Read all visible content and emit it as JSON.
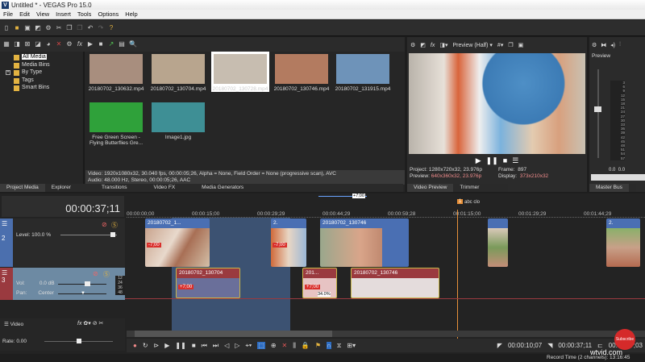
{
  "app": {
    "title": "Untitled * - VEGAS Pro 15.0",
    "logo": "V"
  },
  "menu": [
    "File",
    "Edit",
    "View",
    "Insert",
    "Tools",
    "Options",
    "Help"
  ],
  "media": {
    "tree": [
      {
        "label": "All Media",
        "selected": true
      },
      {
        "label": "Media Bins"
      },
      {
        "label": "By Type",
        "expandable": true
      },
      {
        "label": "Tags"
      },
      {
        "label": "Smart Bins"
      }
    ],
    "thumbs": [
      {
        "label": "20180702_130632.mp4",
        "bg": "#a88e7e"
      },
      {
        "label": "20180702_130704.mp4",
        "bg": "#b8a58e"
      },
      {
        "label": "20180702_130728.mp4",
        "bg": "#c7bdb0",
        "selected": true
      },
      {
        "label": "20180702_130746.mp4",
        "bg": "#b37b60"
      },
      {
        "label": "20180702_131915.mp4",
        "bg": "#6e93b9"
      },
      {
        "label": "Free Green Screen - Flying Butterflies Gre...",
        "bg": "#2fa13a"
      },
      {
        "label": "Image1.jpg",
        "bg": "#3e8f95"
      }
    ],
    "info_video": "Video: 1920x1080x32, 30.040 fps, 00:00:05;26, Alpha = None, Field Order = None (progressive scan), AVC",
    "info_audio": "Audio: 48.000 Hz, Stereo, 00:00:05;26, AAC",
    "tabs": [
      "Project Media",
      "Explorer",
      "Transitions",
      "Video FX",
      "Media Generators"
    ]
  },
  "preview": {
    "quality": "Preview (Half)",
    "project_label": "Project:",
    "project": "1280x720x32, 23.976p",
    "preview_label": "Preview:",
    "preview": "640x360x32, 23.976p",
    "frame_label": "Frame:",
    "frame": "897",
    "display_label": "Display:",
    "display": "373x210x32",
    "tabs": [
      "Video Preview",
      "Trimmer"
    ]
  },
  "bus": {
    "label": "Preview",
    "scale": [
      "3",
      "6",
      "9",
      "12",
      "15",
      "18",
      "21",
      "24",
      "27",
      "30",
      "33",
      "36",
      "39",
      "42",
      "45",
      "48",
      "51",
      "54",
      "57"
    ],
    "left": "0.0",
    "right": "0.0",
    "tab": "Master Bus"
  },
  "timeline": {
    "timecode": "00:00:37;11",
    "ruler": [
      "00:00:00;00",
      "00:00:15;00",
      "00:00:29;29",
      "00:00:44;29",
      "00:00:59;28",
      "00:01:15;00",
      "00:01:29;29",
      "00:01:44;29"
    ],
    "marker": {
      "num": "1",
      "label": "abc clo"
    },
    "loop_badge": "+7;00",
    "track2": {
      "num": "2",
      "level": "Level: 100.0 %"
    },
    "track3": {
      "num": "3",
      "vol_label": "Vol:",
      "vol": "0.0 dB",
      "pan_label": "Pan:",
      "pan": "Center",
      "meter": [
        "12",
        "24",
        "36",
        "48"
      ]
    },
    "clips_video": [
      {
        "name": "20180702_1...",
        "badge": "-7;00"
      },
      {
        "name": "2.",
        "badge": "-7;00"
      },
      {
        "name": "20180702_130746"
      },
      {
        "name": ""
      },
      {
        "name": "2."
      }
    ],
    "clips_audio": [
      {
        "name": "20180702_130704",
        "badge": "+7;00"
      },
      {
        "name": "201...",
        "badge": "+7;00",
        "pct": "34.0%"
      },
      {
        "name": "20180702_130746"
      }
    ],
    "bus_track": {
      "label": "Video",
      "rate": "Rate: 0.00"
    }
  },
  "transport": {
    "in": "00:00:10;07",
    "out": "00:00:37;11",
    "len": "00:00:27;03"
  },
  "status": {
    "record": "Record Time (2 channels): 13:16:45"
  },
  "overlay": {
    "subscribe": "Subscribe",
    "watermark": "wtvid.com"
  }
}
